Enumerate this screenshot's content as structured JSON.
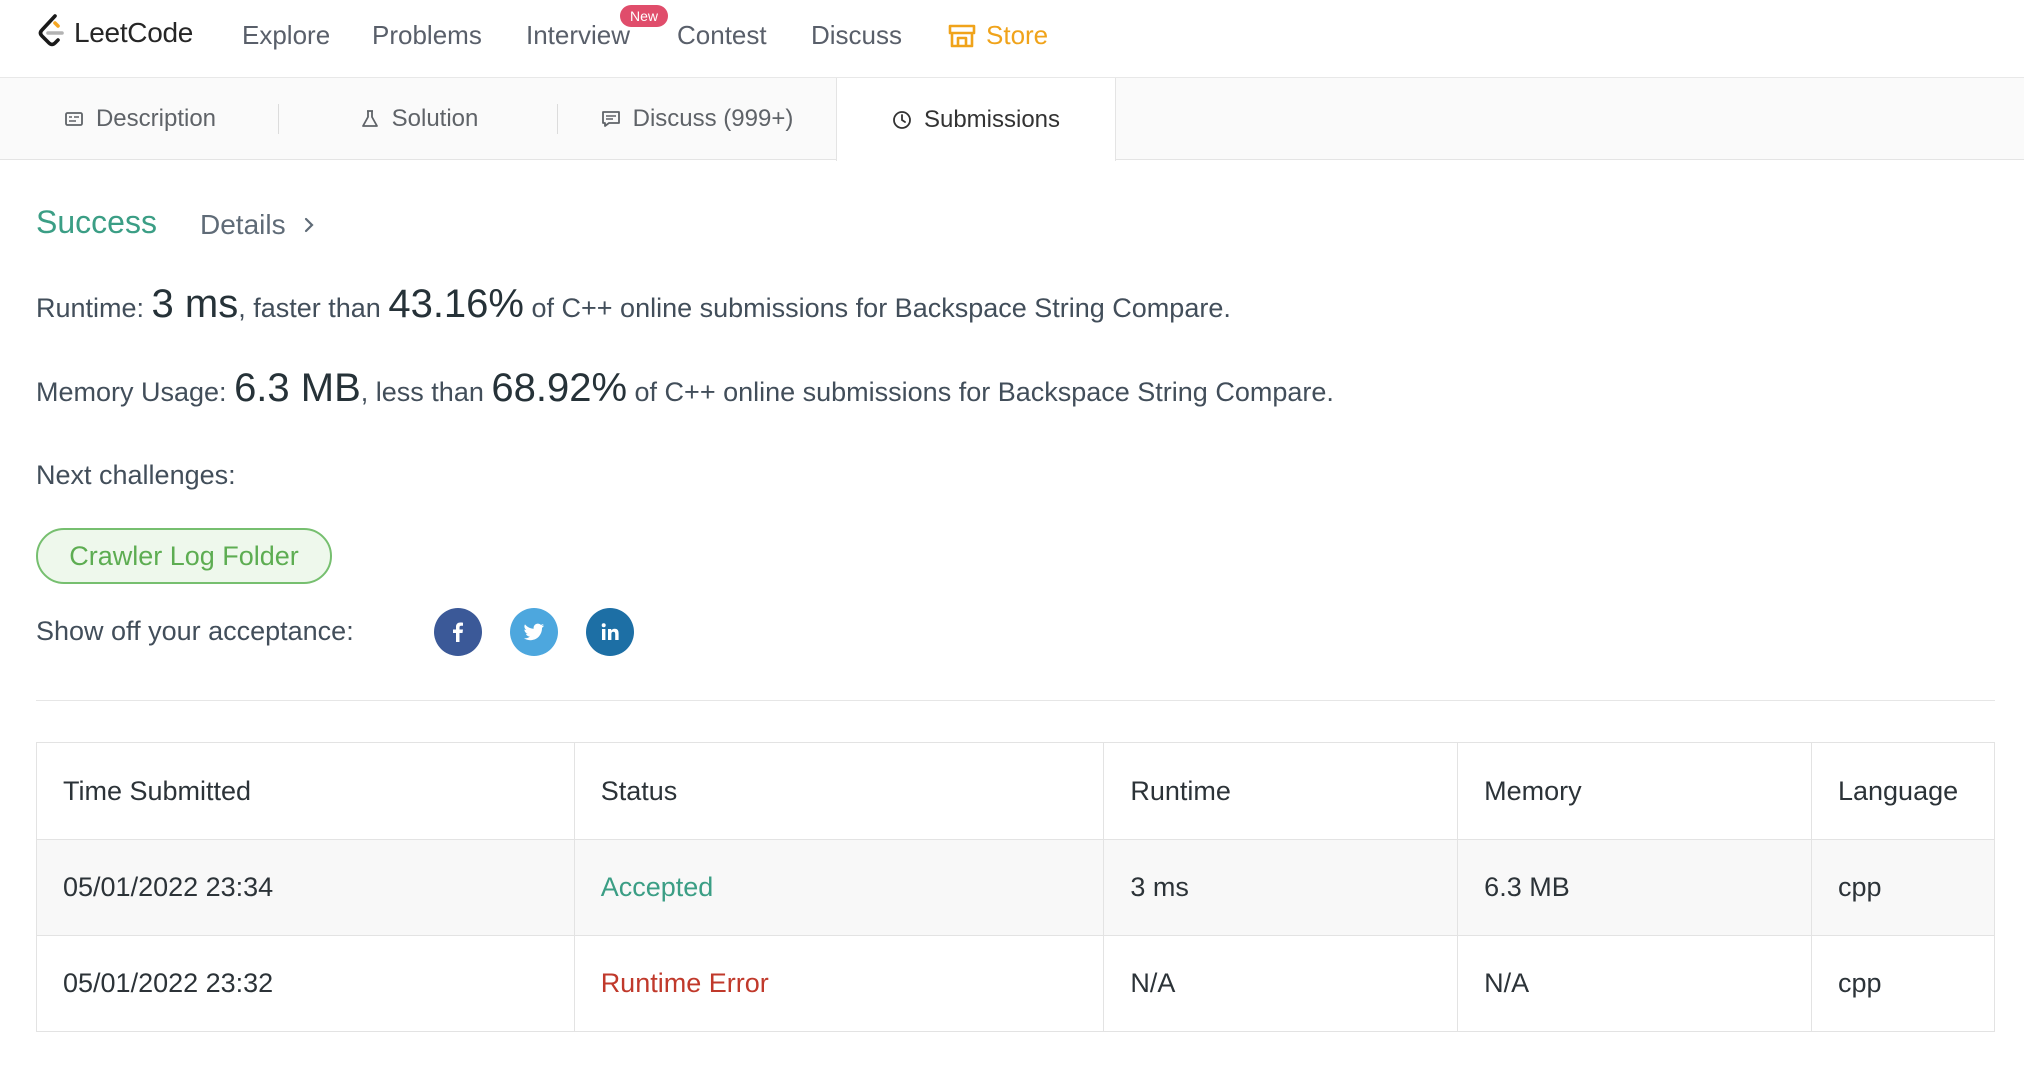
{
  "app": {
    "name": "LeetCode"
  },
  "nav": {
    "items": [
      "Explore",
      "Problems",
      "Interview",
      "Contest",
      "Discuss"
    ],
    "new_badge": "New",
    "store": "Store"
  },
  "tabs": [
    {
      "label": "Description",
      "icon": "description-icon"
    },
    {
      "label": "Solution",
      "icon": "flask-icon"
    },
    {
      "label": "Discuss (999+)",
      "icon": "comment-icon"
    },
    {
      "label": "Submissions",
      "icon": "clock-icon",
      "active": true
    }
  ],
  "result": {
    "status": "Success",
    "details_label": "Details",
    "runtime": {
      "label": "Runtime: ",
      "value": "3 ms",
      "mid": ", faster than ",
      "percent": "43.16%",
      "suffix": " of C++ online submissions for Backspace String Compare."
    },
    "memory": {
      "label": "Memory Usage: ",
      "value": "6.3 MB",
      "mid": ", less than ",
      "percent": "68.92%",
      "suffix": " of C++ online submissions for Backspace String Compare."
    },
    "next_label": "Next challenges:",
    "next_challenge": "Crawler Log Folder",
    "share_label": "Show off your acceptance:"
  },
  "submissions": {
    "columns": [
      "Time Submitted",
      "Status",
      "Runtime",
      "Memory",
      "Language"
    ],
    "rows": [
      {
        "time": "05/01/2022 23:34",
        "status": "Accepted",
        "runtime": "3 ms",
        "memory": "6.3 MB",
        "language": "cpp"
      },
      {
        "time": "05/01/2022 23:32",
        "status": "Runtime Error",
        "runtime": "N/A",
        "memory": "N/A",
        "language": "cpp"
      }
    ]
  },
  "colors": {
    "accent_green": "#3b9e85",
    "error_red": "#c0392b",
    "store_orange": "#f0a31a",
    "new_badge": "#e04d6b",
    "facebook": "#3b5998",
    "twitter": "#4da7de",
    "linkedin": "#1d6fa5"
  }
}
